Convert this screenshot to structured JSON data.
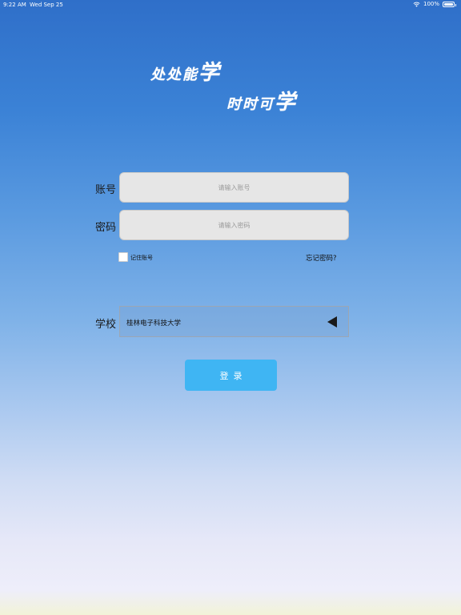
{
  "status_bar": {
    "time": "9:22 AM",
    "date": "Wed Sep 25",
    "battery": "100%"
  },
  "slogan": {
    "line1_prefix": "处处能",
    "line1_big": "学",
    "line2_prefix": "时时可",
    "line2_big": "学"
  },
  "form": {
    "account_label": "账号",
    "account_placeholder": "请输入账号",
    "account_value": "",
    "password_label": "密码",
    "password_placeholder": "请输入密码",
    "password_value": "",
    "remember_label": "记住账号",
    "remember_checked": false,
    "forgot_label": "忘记密码?",
    "school_label": "学校",
    "school_value": "桂林电子科技大学",
    "login_label": "登录"
  },
  "colors": {
    "login_button": "#3fb5f3",
    "input_background": "#e6e6e6"
  }
}
